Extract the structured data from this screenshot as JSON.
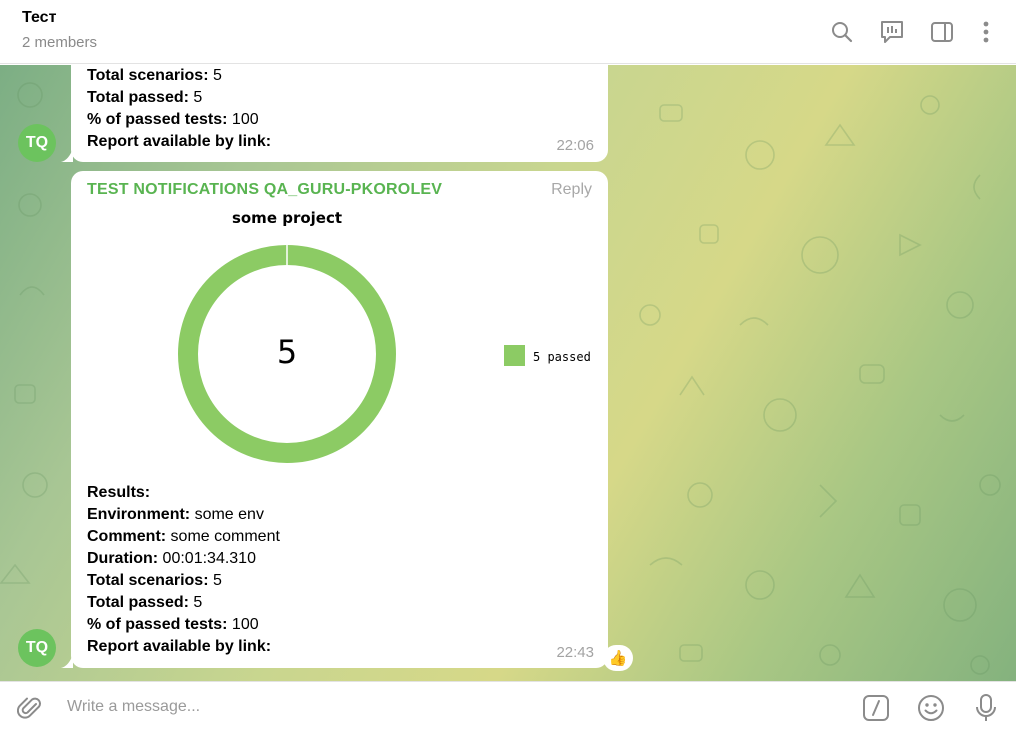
{
  "header": {
    "title": "Тест",
    "subtitle": "2 members"
  },
  "messages": [
    {
      "avatar": "TQ",
      "lines": [
        {
          "label": "Total scenarios:",
          "value": " 5"
        },
        {
          "label": "Total passed:",
          "value": " 5"
        },
        {
          "label": "% of passed tests:",
          "value": " 100"
        },
        {
          "label": "Report available by link:",
          "value": ""
        }
      ],
      "time": "22:06"
    },
    {
      "avatar": "TQ",
      "sender": "TEST NOTIFICATIONS QA_GURU-PKOROLEV",
      "reply_label": "Reply",
      "lines": [
        {
          "label": "Results:",
          "value": ""
        },
        {
          "label": "Environment:",
          "value": " some env"
        },
        {
          "label": "Comment:",
          "value": " some comment"
        },
        {
          "label": "Duration:",
          "value": " 00:01:34.310"
        },
        {
          "label": "Total scenarios:",
          "value": " 5"
        },
        {
          "label": "Total passed:",
          "value": " 5"
        },
        {
          "label": "% of passed tests:",
          "value": " 100"
        },
        {
          "label": "Report available by link:",
          "value": ""
        }
      ],
      "time": "22:43",
      "reaction": "👍"
    }
  ],
  "chart_data": {
    "type": "pie",
    "title": "some project",
    "center_label": "5",
    "series": [
      {
        "name": "passed",
        "value": 5,
        "color": "#8ccb64"
      }
    ],
    "legend": [
      {
        "label": "5 passed",
        "color": "#8ccb64"
      }
    ],
    "legend_position": "right"
  },
  "input": {
    "placeholder": "Write a message..."
  },
  "icons": {
    "search": "search-icon",
    "stats": "stats-icon",
    "sidebar": "sidebar-toggle-icon",
    "more": "more-vertical-icon",
    "attach": "paperclip-icon",
    "commands": "slash-commands-icon",
    "emoji": "emoji-icon",
    "mic": "microphone-icon"
  },
  "colors": {
    "accent": "#59b451",
    "avatar": "#6cc35e",
    "chart": "#8ccb64"
  }
}
